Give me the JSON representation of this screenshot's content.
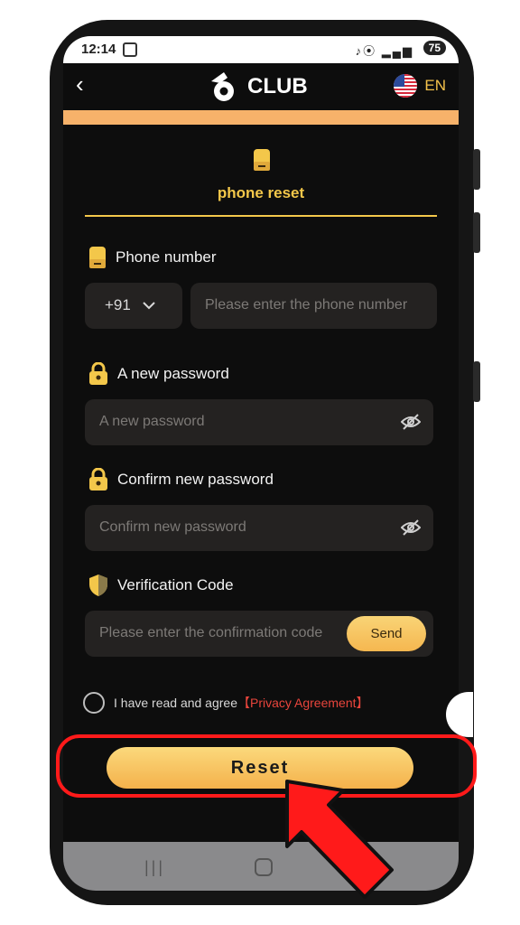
{
  "status_bar": {
    "time": "12:14",
    "icons": "♪⦿ ▂▄▆",
    "battery": "75"
  },
  "header": {
    "back_icon": "back-arrow-icon",
    "logo_text": "CLUB",
    "language": "EN"
  },
  "tab": {
    "label": "phone reset"
  },
  "phone": {
    "label": "Phone number",
    "country_code": "+91",
    "placeholder": "Please enter the phone number"
  },
  "new_password": {
    "label": "A new password",
    "placeholder": "A new password"
  },
  "confirm_password": {
    "label": "Confirm new password",
    "placeholder": "Confirm new password"
  },
  "verification": {
    "label": "Verification Code",
    "placeholder": "Please enter the confirmation code",
    "send_label": "Send"
  },
  "agreement": {
    "text": "I have read and agree",
    "link": "【Privacy Agreement】"
  },
  "reset_label": "Reset",
  "colors": {
    "accent": "#f3c74a",
    "button": "#f7b84f",
    "link": "#e8453c",
    "highlight": "#ff1a1a"
  }
}
